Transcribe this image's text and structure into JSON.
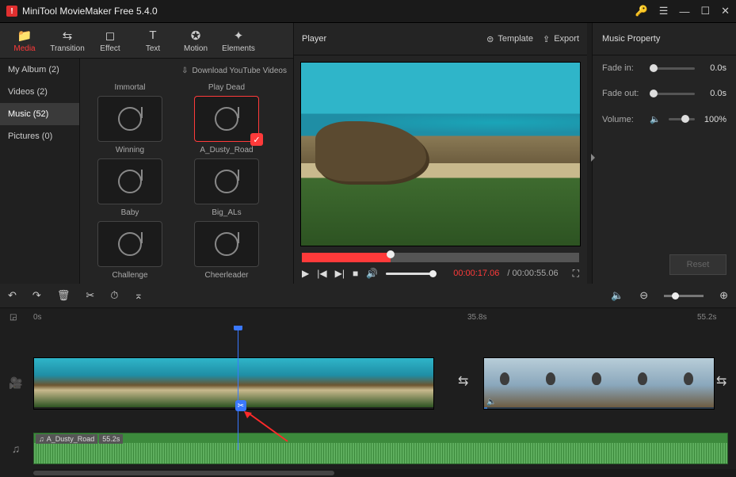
{
  "titlebar": {
    "app_title": "MiniTool MovieMaker Free 5.4.0"
  },
  "toolbar": {
    "media": "Media",
    "transition": "Transition",
    "effect": "Effect",
    "text": "Text",
    "motion": "Motion",
    "elements": "Elements"
  },
  "categories": {
    "my_album": "My Album (2)",
    "videos": "Videos (2)",
    "music": "Music (52)",
    "pictures": "Pictures (0)"
  },
  "grid": {
    "download_label": "Download YouTube Videos",
    "row1": [
      "Immortal",
      "Play Dead"
    ],
    "row2": [
      "Winning",
      "A_Dusty_Road"
    ],
    "row3": [
      "Baby",
      "Big_ALs"
    ],
    "row4": [
      "Challenge",
      "Cheerleader"
    ]
  },
  "player": {
    "title": "Player",
    "template": "Template",
    "export": "Export",
    "time_current": "00:00:17.06",
    "time_total": "/ 00:00:55.06"
  },
  "props": {
    "title": "Music Property",
    "fadein_label": "Fade in:",
    "fadein_val": "0.0s",
    "fadeout_label": "Fade out:",
    "fadeout_val": "0.0s",
    "volume_label": "Volume:",
    "volume_val": "100%",
    "reset": "Reset"
  },
  "ruler": {
    "t0": "0s",
    "t1": "35.8s",
    "t2": "55.2s"
  },
  "audio_clip": {
    "name": "A_Dusty_Road",
    "dur": "55.2s"
  }
}
